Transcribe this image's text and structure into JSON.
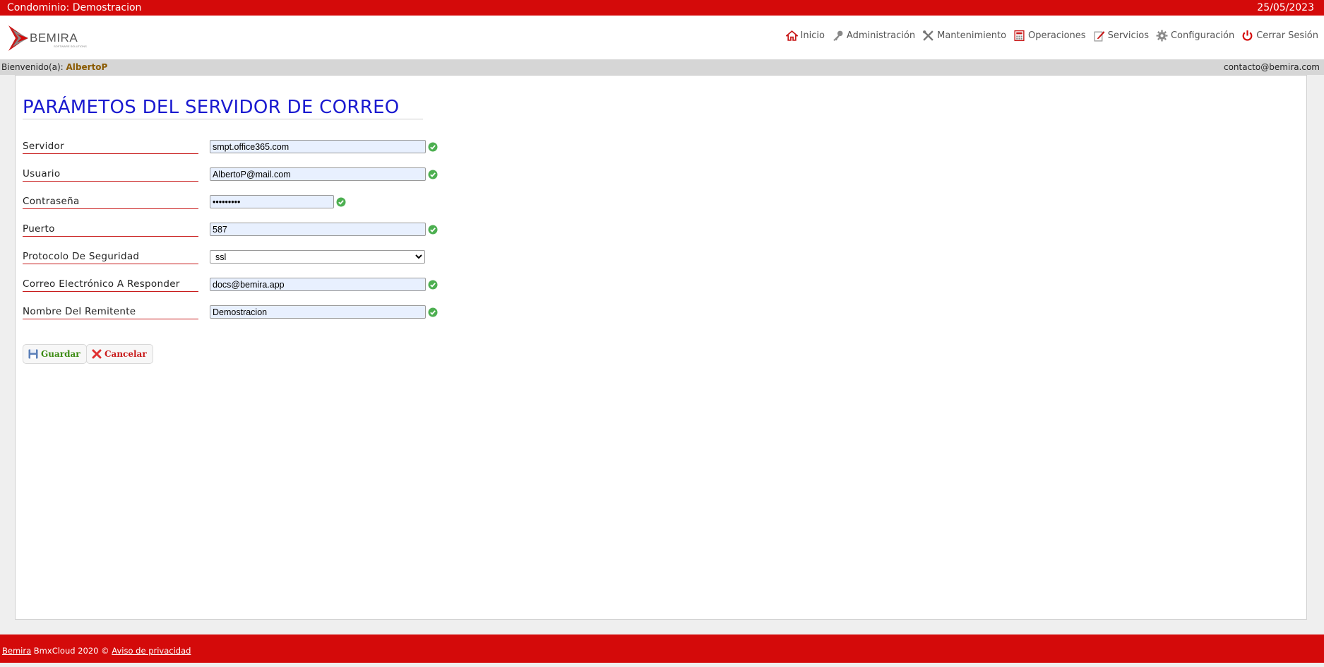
{
  "topbar": {
    "condominio": "Condominio: Demostracion",
    "date": "25/05/2023"
  },
  "logo": {
    "text": "BEMIRA",
    "tagline": "SOFTWARE SOLUTIONS",
    "red": "#d40a0a",
    "gray": "#666666"
  },
  "nav": {
    "items": [
      {
        "label": "Inicio",
        "icon": "home-icon"
      },
      {
        "label": "Administración",
        "icon": "key-icon"
      },
      {
        "label": "Mantenimiento",
        "icon": "tools-icon"
      },
      {
        "label": "Operaciones",
        "icon": "calculator-icon"
      },
      {
        "label": "Servicios",
        "icon": "edit-icon"
      },
      {
        "label": "Configuración",
        "icon": "gear-icon"
      },
      {
        "label": "Cerrar Sesión",
        "icon": "power-icon"
      }
    ]
  },
  "welcome": {
    "label": "Bienvenido(a): ",
    "user": "AlbertoP",
    "contact": "contacto@bemira.com"
  },
  "page": {
    "title": "PARÁMETOS DEL SERVIDOR DE CORREO"
  },
  "form": {
    "servidor": {
      "label": "Servidor",
      "value": "smpt.office365.com"
    },
    "usuario": {
      "label": "Usuario",
      "value": "AlbertoP@mail.com"
    },
    "contrasena": {
      "label": "Contraseña",
      "value": "•••••••••"
    },
    "puerto": {
      "label": "Puerto",
      "value": "587"
    },
    "protocolo": {
      "label": "Protocolo De Seguridad",
      "value": "ssl"
    },
    "responder": {
      "label": "Correo Electrónico A Responder",
      "value": "docs@bemira.app"
    },
    "remitente": {
      "label": "Nombre Del Remitente",
      "value": "Demostracion"
    }
  },
  "buttons": {
    "save": "Guardar",
    "cancel": "Cancelar",
    "save_color": "#3a8a10",
    "cancel_color": "#c81a1a"
  },
  "footer": {
    "brand": "Bemira",
    "text": " BmxCloud 2020 © ",
    "privacy": "Aviso de privacidad"
  },
  "colors": {
    "red": "#d40a0a",
    "title_blue": "#1a1ad0",
    "ok_green": "#4caf50"
  }
}
